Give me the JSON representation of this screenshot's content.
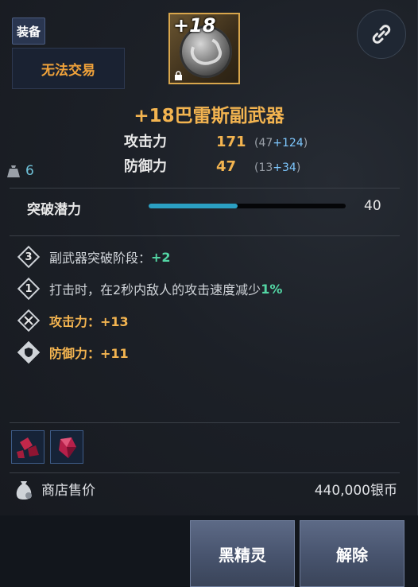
{
  "header": {
    "equip_tag": "装备",
    "trade_tag": "无法交易",
    "enhance_level": "+18"
  },
  "item": {
    "name": "+18巴雷斯副武器",
    "stats": [
      {
        "label": "攻击力",
        "value": "171",
        "base": "(47",
        "bonus": "+124",
        "close": ")"
      },
      {
        "label": "防御力",
        "value": "47",
        "base": "(13",
        "bonus": "+34",
        "close": ")"
      }
    ],
    "weight": "6"
  },
  "breakthrough": {
    "label": "突破潜力",
    "value": "40",
    "fill_fraction": 0.45
  },
  "effects": [
    {
      "icon": "3",
      "text": "副武器突破阶段：",
      "highlight": "+2"
    },
    {
      "icon": "1",
      "text": "打击时，在2秒内敌人的攻击速度减少",
      "highlight": "1%"
    },
    {
      "text": "攻击力：+13"
    },
    {
      "text": "防御力：+11"
    }
  ],
  "price": {
    "label": "商店售价",
    "value": "440,000银币"
  },
  "buttons": {
    "dark_elf": "黑精灵",
    "release": "解除"
  },
  "colors": {
    "gold": "#f3b450",
    "green": "#53d6a4",
    "bar": "#2ba0c3"
  },
  "icons": [
    "link-icon",
    "weight-icon",
    "coin-bag-icon",
    "lock-icon"
  ]
}
